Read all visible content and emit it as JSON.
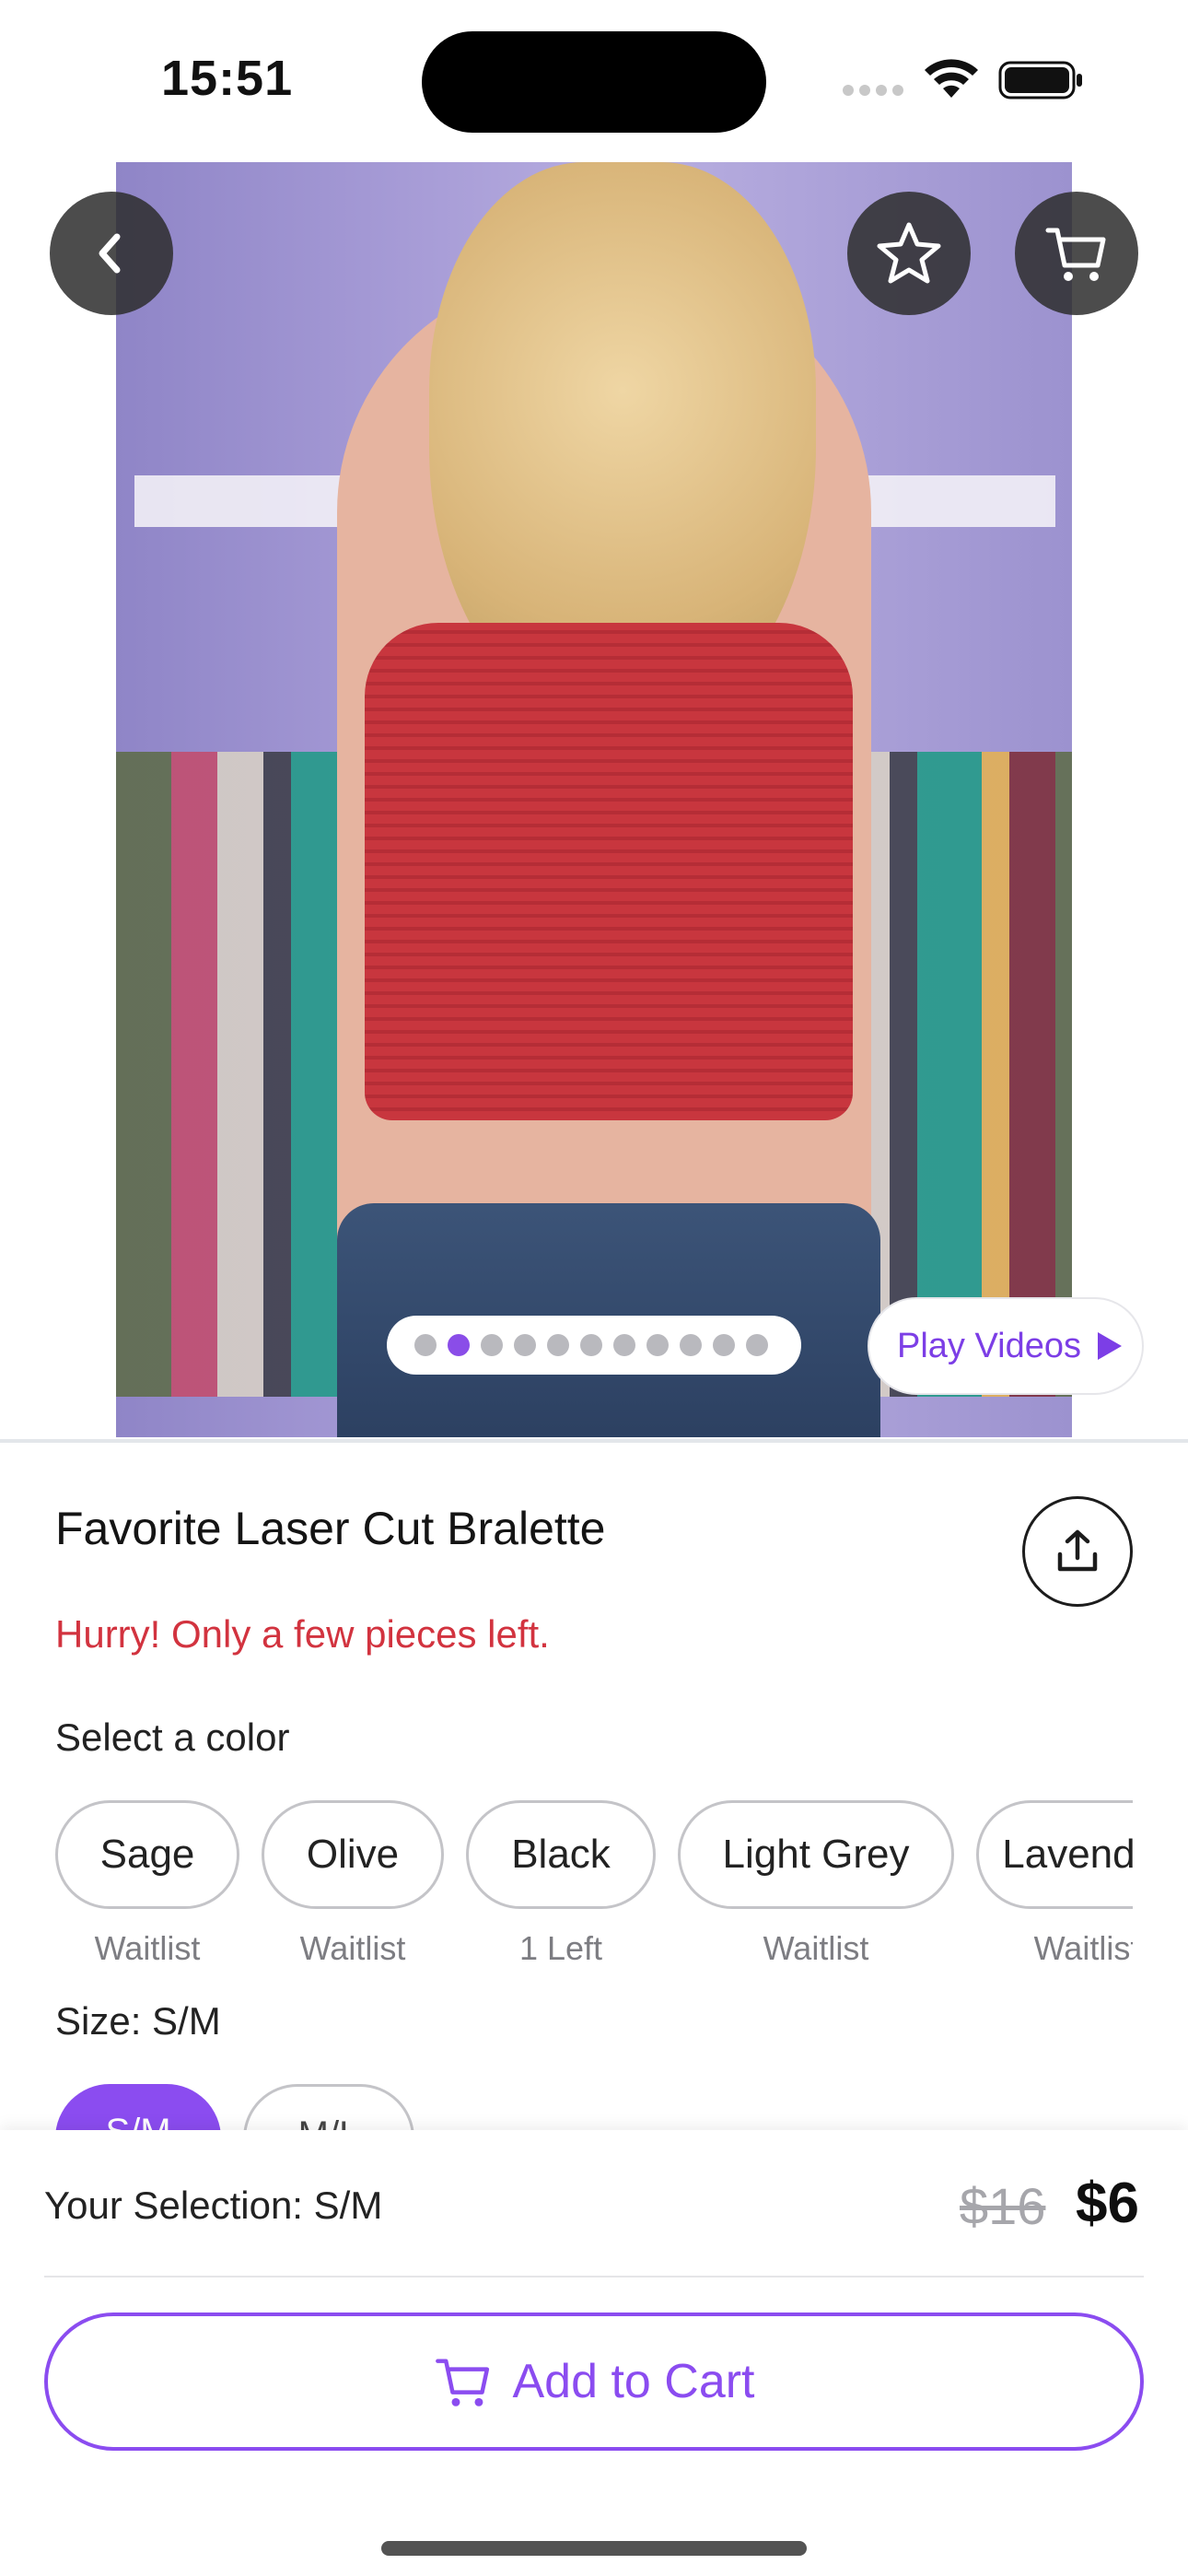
{
  "status_bar": {
    "time": "15:51"
  },
  "hero": {
    "total_images": 11,
    "active_index": 1
  },
  "play_videos": {
    "label": "Play Videos"
  },
  "product": {
    "title": "Favorite Laser Cut Bralette",
    "stock_message": "Hurry! Only a few pieces left."
  },
  "colors": {
    "label": "Select a color",
    "options": [
      {
        "name": "Sage",
        "status": "Waitlist"
      },
      {
        "name": "Olive",
        "status": "Waitlist"
      },
      {
        "name": "Black",
        "status": "1 Left"
      },
      {
        "name": "Light Grey",
        "status": "Waitlist"
      },
      {
        "name": "Lavender",
        "status": "Waitlist"
      }
    ]
  },
  "size": {
    "label": "Size: S/M",
    "options": [
      "S/M",
      "M/L"
    ],
    "selected": "S/M"
  },
  "footer": {
    "selection": "Your Selection: S/M",
    "original_price": "$16",
    "price": "$6",
    "add_to_cart": "Add to Cart"
  },
  "colors_theme": {
    "accent": "#8b4cf0",
    "alert": "#d2333f"
  }
}
